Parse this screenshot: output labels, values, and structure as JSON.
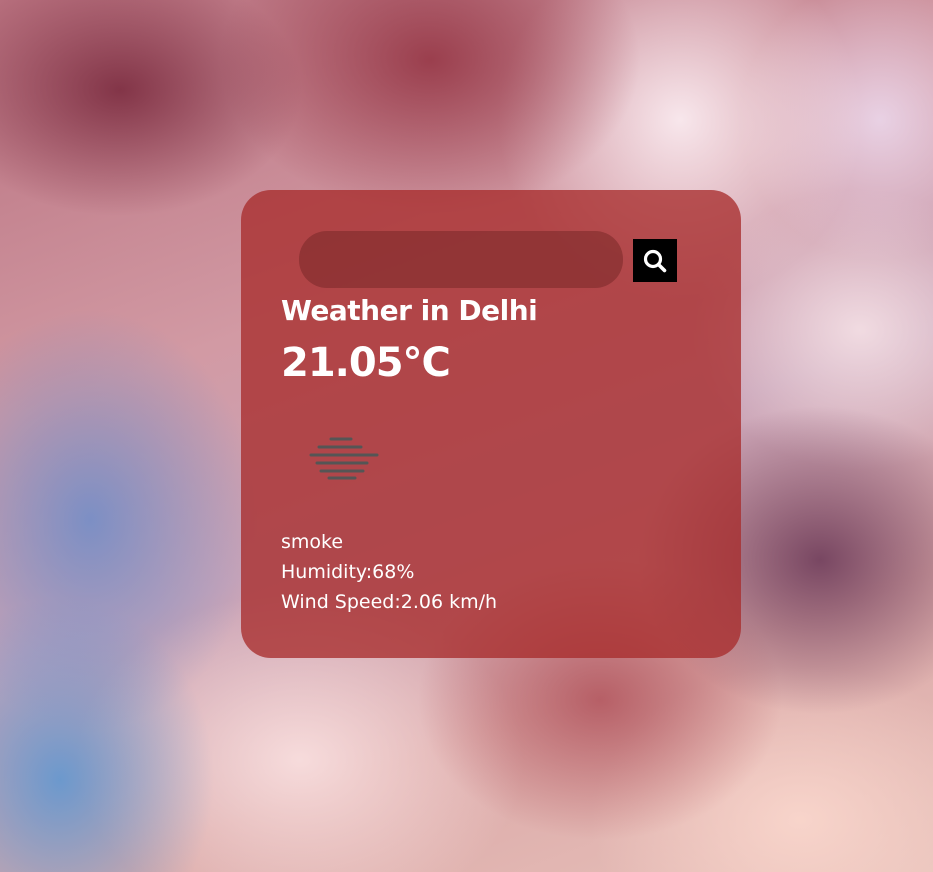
{
  "search": {
    "value": "",
    "placeholder": "",
    "button_icon": "search-icon"
  },
  "weather": {
    "title": "Weather in Delhi",
    "temperature": "21.05°C",
    "icon": "haze-icon",
    "description": "smoke",
    "humidity": "Humidity:68%",
    "wind": "Wind Speed:2.06 km/h"
  },
  "colors": {
    "card_background": "#a82d2d",
    "search_button": "#000000",
    "text": "#ffffff",
    "icon_lines": "#555555"
  }
}
